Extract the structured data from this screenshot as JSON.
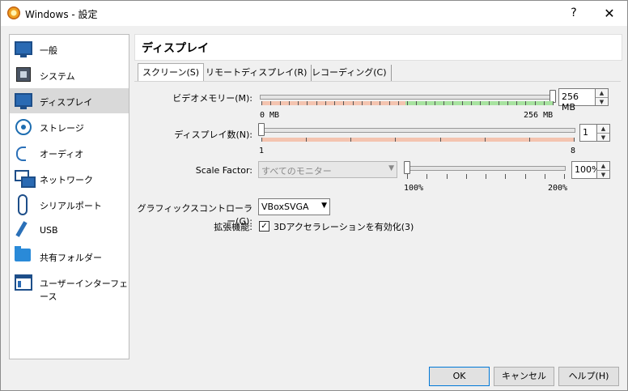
{
  "window": {
    "title": "Windows - 設定",
    "help_label": "?",
    "close_label": "✕"
  },
  "sidebar": {
    "items": [
      {
        "label": "一般",
        "icon": "monitor-icon"
      },
      {
        "label": "システム",
        "icon": "chip-icon"
      },
      {
        "label": "ディスプレイ",
        "icon": "display-icon",
        "selected": true
      },
      {
        "label": "ストレージ",
        "icon": "disk-icon"
      },
      {
        "label": "オーディオ",
        "icon": "audio-icon"
      },
      {
        "label": "ネットワーク",
        "icon": "network-icon"
      },
      {
        "label": "シリアルポート",
        "icon": "serial-port-icon"
      },
      {
        "label": "USB",
        "icon": "usb-icon"
      },
      {
        "label": "共有フォルダー",
        "icon": "shared-folder-icon"
      },
      {
        "label": "ユーザーインターフェース",
        "icon": "user-interface-icon"
      }
    ]
  },
  "panel": {
    "title": "ディスプレイ",
    "tabs": [
      {
        "label": "スクリーン(S)",
        "active": true
      },
      {
        "label": "リモートディスプレイ(R)"
      },
      {
        "label": "レコーディング(C)"
      }
    ]
  },
  "screen": {
    "video_memory": {
      "label": "ビデオメモリー(M):",
      "value": "256 MB",
      "min_label": "0 MB",
      "max_label": "256 MB",
      "level": 1.0
    },
    "monitor_count": {
      "label": "ディスプレイ数(N):",
      "value": "1",
      "min_label": "1",
      "max_label": "8",
      "level": 0.0
    },
    "scale_factor": {
      "label": "Scale Factor:",
      "monitor_select": "すべてのモニター",
      "value": "100%",
      "min_label": "100%",
      "max_label": "200%",
      "level": 0.0
    },
    "graphics_controller": {
      "label": "グラフィックスコントローラー(G):",
      "value": "VBoxSVGA"
    },
    "acceleration": {
      "label": "拡張機能:",
      "checkbox_label": "3Dアクセラレーションを有効化(3)",
      "checked": true,
      "check_mark": "✓"
    }
  },
  "buttons": {
    "ok": "OK",
    "cancel": "キャンセル",
    "help": "ヘルプ(H)"
  },
  "colors": {
    "range_red": "#f4c4b0",
    "range_green": "#a8e3a0",
    "selection": "#d9d9d9",
    "accent": "#0078d7"
  },
  "icons": {
    "spin_up": "▲",
    "spin_down": "▼",
    "combo_arrow": "▼"
  }
}
